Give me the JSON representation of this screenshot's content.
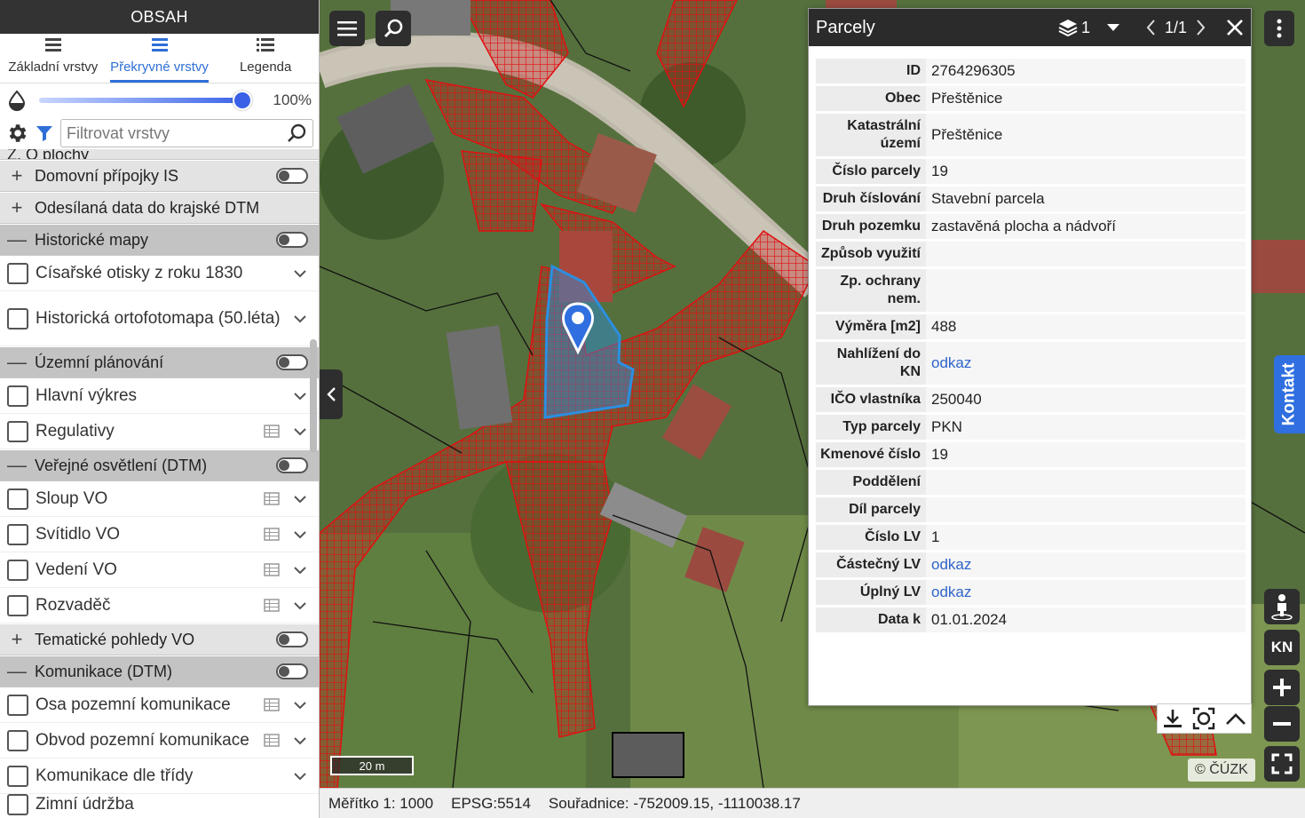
{
  "left_panel": {
    "title": "OBSAH",
    "tabs": [
      {
        "label": "Základní vrstvy"
      },
      {
        "label": "Překryvné vrstvy"
      },
      {
        "label": "Legenda"
      }
    ],
    "opacity_label": "100%",
    "opacity_value": 1.0,
    "filter_placeholder": "Filtrovat vrstvy",
    "partial_top_label": "Z. O plochy",
    "partial_bottom_label": "Zimní údržba",
    "groups": {
      "g1": "Domovní přípojky IS",
      "g2": "Odesílaná data do krajské DTM",
      "g3": "Historické mapy",
      "g4": "Územní plánování",
      "g5": "Veřejné osvětlení (DTM)",
      "g6": "Tematické pohledy VO",
      "g7": "Komunikace (DTM)"
    },
    "items": {
      "i1": "Císařské otisky z roku 1830",
      "i2": "Historická ortofotomapa (50.léta)",
      "i3": "Hlavní výkres",
      "i4": "Regulativy",
      "i5": "Sloup VO",
      "i6": "Svítidlo VO",
      "i7": "Vedení VO",
      "i8": "Rozvaděč",
      "i9": "Osa pozemní komunikace",
      "i10": "Obvod pozemní komunikace",
      "i11": "Komunikace dle třídy"
    }
  },
  "map": {
    "scale_bar": "20 m",
    "attribution": "© ČÚZK",
    "side_tab": "Kontakt",
    "kn_button": "KN",
    "colors": {
      "parcel_hatch": "#e01010",
      "selection": "#2b8fe0",
      "accent": "#2f6fe0"
    }
  },
  "popup": {
    "title": "Parcely",
    "layer_count": "1",
    "pager": "1/1",
    "rows": [
      {
        "label": "ID",
        "value": "2764296305"
      },
      {
        "label": "Obec",
        "value": "Přeštěnice"
      },
      {
        "label": "Katastrální území",
        "value": "Přeštěnice"
      },
      {
        "label": "Číslo parcely",
        "value": "19"
      },
      {
        "label": "Druh číslování",
        "value": "Stavební parcela"
      },
      {
        "label": "Druh pozemku",
        "value": "zastavěná plocha a nádvoří"
      },
      {
        "label": "Způsob využití",
        "value": ""
      },
      {
        "label": "Zp. ochrany nem.",
        "value": ""
      },
      {
        "label": "Výměra [m2]",
        "value": "488"
      },
      {
        "label": "Nahlížení do KN",
        "value": "odkaz"
      },
      {
        "label": "IČO vlastníka",
        "value": "250040"
      },
      {
        "label": "Typ parcely",
        "value": "PKN"
      },
      {
        "label": "Kmenové číslo",
        "value": "19"
      },
      {
        "label": "Poddělení",
        "value": ""
      },
      {
        "label": "Díl parcely",
        "value": ""
      },
      {
        "label": "Číslo LV",
        "value": "1"
      },
      {
        "label": "Částečný LV",
        "value": "odkaz"
      },
      {
        "label": "Úplný LV",
        "value": "odkaz"
      },
      {
        "label": "Data k",
        "value": "01.01.2024"
      }
    ]
  },
  "status_bar": {
    "scale": "Měřítko 1: 1000",
    "epsg": "EPSG:5514",
    "coords": "Souřadnice: -752009.15, -1110038.17"
  }
}
